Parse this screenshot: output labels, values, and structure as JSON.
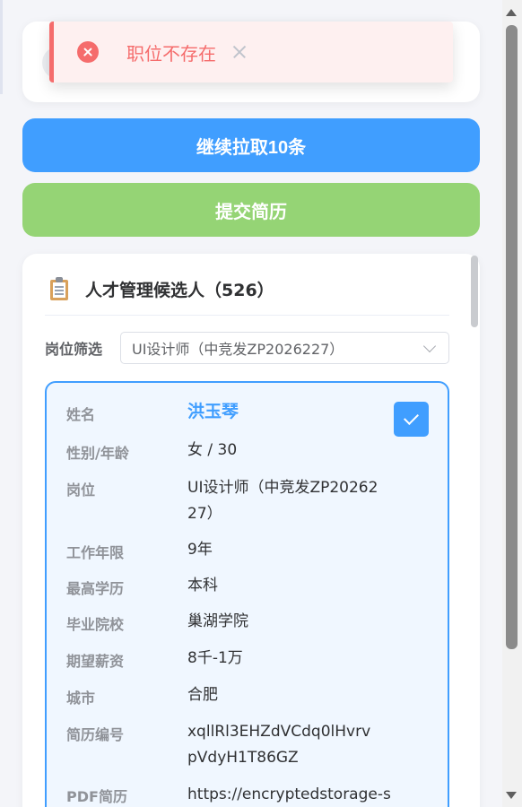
{
  "toast": {
    "message": "职位不存在"
  },
  "buttons": {
    "pull_more": "继续拉取10条",
    "submit_resume": "提交简历"
  },
  "colors": {
    "primary": "#409eff",
    "success": "#95d475",
    "error": "#f56c6c"
  },
  "panel": {
    "title": "人才管理候选人（526）",
    "filter_label": "岗位筛选",
    "filter_selected": "UI设计师（中竞发ZP2026227）"
  },
  "candidate": {
    "selected": true,
    "fields": [
      {
        "label": "姓名",
        "value": "洪玉琴"
      },
      {
        "label": "性别/年龄",
        "value": "女 / 30"
      },
      {
        "label": "岗位",
        "value": "UI设计师（中竞发ZP2026227）"
      },
      {
        "label": "工作年限",
        "value": "9年"
      },
      {
        "label": "最高学历",
        "value": "本科"
      },
      {
        "label": "毕业院校",
        "value": "巢湖学院"
      },
      {
        "label": "期望薪资",
        "value": "8千-1万"
      },
      {
        "label": "城市",
        "value": "合肥"
      },
      {
        "label": "简历编号",
        "value": "xqllRl3EHZdVCdq0lHvrvpVdyH1T86GZ"
      },
      {
        "label": "PDF简历",
        "value": "https://encryptedstorage-st"
      }
    ]
  }
}
